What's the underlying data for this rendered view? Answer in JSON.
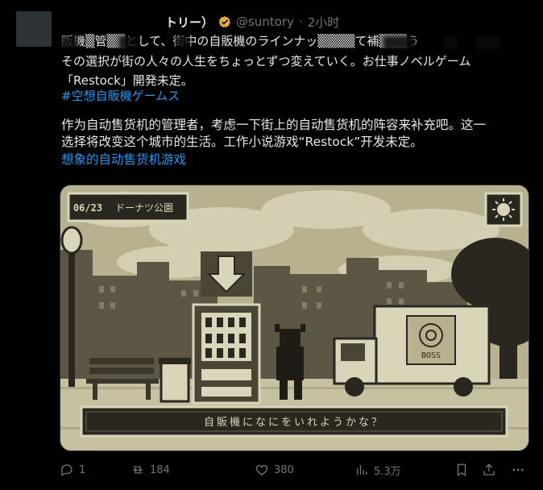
{
  "tweet": {
    "display_name": "トリー）",
    "handle": "@suntory",
    "separator": "·",
    "time": "2小时",
    "jp_line1": "販機▒管▒▒として、街中の自販機のラインナッ▒▒▒▒て補▒▒▒う",
    "jp_line2": "その選択が街の人々の人生をちょっとずつ変えていく。お仕事ノベルゲーム",
    "jp_line3": "「Restock」開発未定。",
    "hashtag": "#空想自販機ゲームス",
    "translation_line1": "作为自动售货机的管理者，考虑一下街上的自动售货机的阵容来补充吧。这一",
    "translation_line2": "选择将改变这个城市的生活。工作小说游戏“Restock”开发未定。",
    "translation_tag": "想象的自动售货机游戏"
  },
  "media": {
    "date": "06/23",
    "location": "ドーナツ公園",
    "dialog": "自販機になにをいれようかな？",
    "truck_logo": "BOSS",
    "colors": {
      "light": "#d9d5b8",
      "mid": "#a49f80",
      "dark": "#4a4534",
      "ink": "#1e1c15"
    }
  },
  "actions": {
    "reply_count": "1",
    "retweet_count": "184",
    "like_count": "380",
    "views_count": "5.3万"
  },
  "colors": {
    "link": "#1d9bf0",
    "muted": "#71767b",
    "verified": "#e8b32a"
  }
}
